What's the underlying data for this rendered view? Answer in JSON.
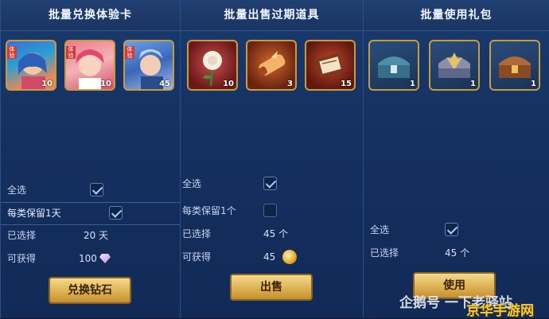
{
  "panel_exchange": {
    "title": "批量兑换体验卡",
    "cards": [
      {
        "icon": "hero-card-icon",
        "count": "10",
        "tag": "体验"
      },
      {
        "icon": "hero-card-icon",
        "count": "10",
        "tag": "体验"
      },
      {
        "icon": "hero-card-icon",
        "count": "45",
        "tag": "体验"
      }
    ],
    "select_all_label": "全选",
    "keep_label": "每类保留1天",
    "selected_label": "已选择",
    "selected_value": "20 天",
    "obtain_label": "可获得",
    "obtain_value": "100",
    "button_label": "兑换钻石"
  },
  "panel_sell": {
    "title": "批量出售过期道具",
    "cards": [
      {
        "icon": "rose-icon",
        "count": "10"
      },
      {
        "icon": "scroll-icon",
        "count": "3"
      },
      {
        "icon": "book-icon",
        "count": "15"
      }
    ],
    "select_all_label": "全选",
    "keep_label": "每类保留1个",
    "selected_label": "已选择",
    "selected_value": "45 个",
    "obtain_label": "可获得",
    "obtain_value": "45",
    "button_label": "出售"
  },
  "panel_use": {
    "title": "批量使用礼包",
    "cards": [
      {
        "icon": "chest-icon",
        "count": "1"
      },
      {
        "icon": "chest-icon",
        "count": "1"
      },
      {
        "icon": "chest-icon",
        "count": "1"
      }
    ],
    "select_all_label": "全选",
    "selected_label": "已选择",
    "selected_value": "45 个",
    "button_label": "使用"
  },
  "watermark": {
    "text": "企鹅号 一下老驿站",
    "site": "京华手游网"
  },
  "colors": {
    "panel_bg": "#163466",
    "gold_border": "#c89b3c",
    "button_gold": "#dcae4e",
    "checkmark": "#9fd0ff"
  }
}
